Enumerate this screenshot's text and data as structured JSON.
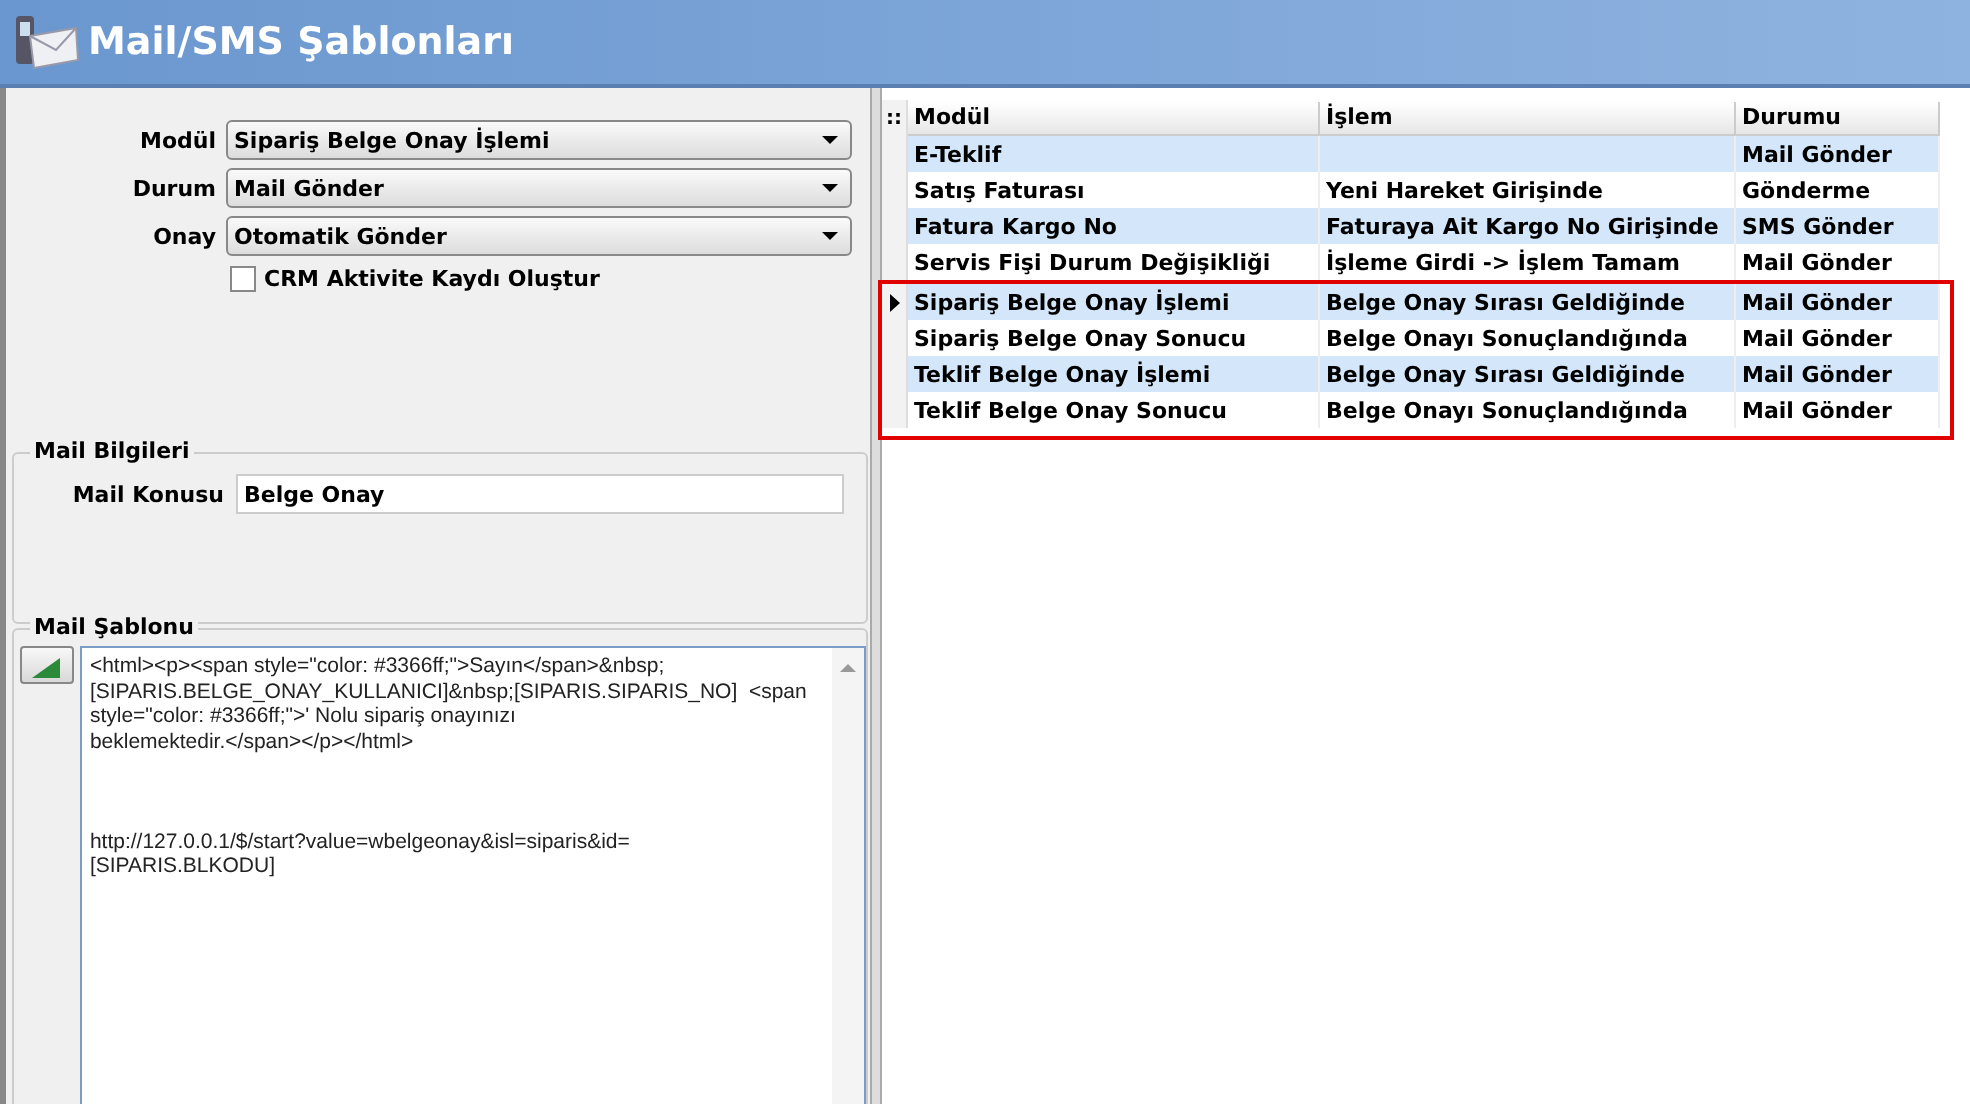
{
  "window": {
    "title": "Mail/SMS Şablonları"
  },
  "form": {
    "fields": [
      {
        "label": "Modül",
        "value": "Sipariş Belge Onay İşlemi"
      },
      {
        "label": "Durum",
        "value": "Mail Gönder"
      },
      {
        "label": "Onay",
        "value": "Otomatik Gönder"
      }
    ],
    "checkbox": {
      "label": "CRM Aktivite Kaydı Oluştur",
      "checked": false
    }
  },
  "mail_info": {
    "title": "Mail Bilgileri",
    "subject_label": "Mail Konusu",
    "subject": "Belge Onay"
  },
  "template": {
    "title": "Mail Şablonu",
    "text": "<html><p><span style=\"color: #3366ff;\">Sayın</span>&nbsp;\n[SIPARIS.BELGE_ONAY_KULLANICI]&nbsp;[SIPARIS.SIPARIS_NO]  <span\nstyle=\"color: #3366ff;\">' Nolu sipariş onayınızı\nbeklemektedir.</span></p></html>\n\n\n\nhttp://127.0.0.1/$/start?value=wbelgeonay&isl=siparis&id=\n[SIPARIS.BLKODU]"
  },
  "table": {
    "corner": "::",
    "columns": [
      "Modül",
      "İşlem",
      "Durumu"
    ],
    "rows": [
      {
        "cells": [
          "E-Teklif",
          "",
          "Mail Gönder"
        ],
        "selected": false,
        "highlighted": false
      },
      {
        "cells": [
          "Satış Faturası",
          "Yeni Hareket Girişinde",
          "Gönderme"
        ],
        "selected": false,
        "highlighted": false
      },
      {
        "cells": [
          "Fatura Kargo No",
          "Faturaya Ait Kargo No Girişinde",
          "SMS Gönder"
        ],
        "selected": false,
        "highlighted": false
      },
      {
        "cells": [
          "Servis Fişi Durum Değişikliği",
          "İşleme Girdi -> İşlem Tamam",
          "Mail Gönder"
        ],
        "selected": false,
        "highlighted": false
      },
      {
        "cells": [
          "Sipariş Belge Onay İşlemi",
          "Belge Onay Sırası Geldiğinde",
          "Mail Gönder"
        ],
        "selected": true,
        "highlighted": true
      },
      {
        "cells": [
          "Sipariş Belge Onay Sonucu",
          "Belge Onayı Sonuçlandığında",
          "Mail Gönder"
        ],
        "selected": false,
        "highlighted": true
      },
      {
        "cells": [
          "Teklif Belge Onay İşlemi",
          "Belge Onay Sırası Geldiğinde",
          "Mail Gönder"
        ],
        "selected": false,
        "highlighted": true
      },
      {
        "cells": [
          "Teklif Belge Onay Sonucu",
          "Belge Onayı Sonuçlandığında",
          "Mail Gönder"
        ],
        "selected": false,
        "highlighted": true
      }
    ]
  }
}
